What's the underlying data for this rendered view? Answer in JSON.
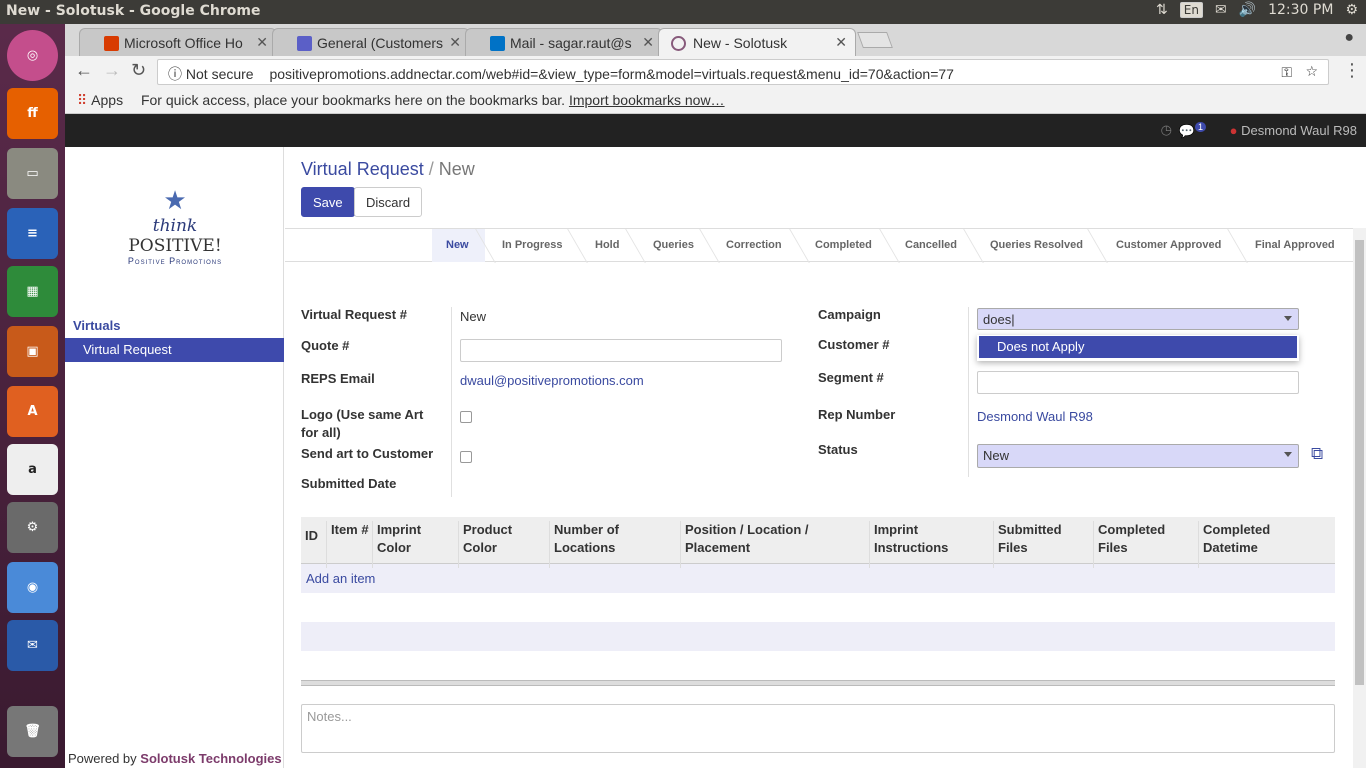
{
  "os": {
    "window_title": "New - Solotusk - Google Chrome",
    "lang": "En",
    "time": "12:30 PM"
  },
  "browser": {
    "tabs": [
      {
        "label": "Microsoft Office Ho",
        "favicon": "office-icon"
      },
      {
        "label": "General (Customers",
        "favicon": "teams-icon"
      },
      {
        "label": "Mail - sagar.raut@s",
        "favicon": "outlook-icon"
      },
      {
        "label": "New - Solotusk",
        "favicon": "odoo-icon"
      }
    ],
    "security": "Not secure",
    "url": "positivepromotions.addnectar.com/web#id=&view_type=form&model=virtuals.request&menu_id=70&action=77",
    "bookmarks_apps": "Apps",
    "bookmarks_hint": "For quick access, place your bookmarks here on the bookmarks bar.",
    "bookmarks_import": "Import bookmarks now…"
  },
  "app": {
    "user": "Desmond Waul R98",
    "chat_count": "1",
    "logo": {
      "line1": "think",
      "line2": "POSITIVE!",
      "line3": "Positive Promotions"
    },
    "sidebar": {
      "section": "Virtuals",
      "item": "Virtual Request"
    },
    "powered_prefix": "Powered by",
    "powered_by": "Solotusk Technologies",
    "breadcrumb": {
      "parent": "Virtual Request",
      "current": "New"
    },
    "buttons": {
      "save": "Save",
      "discard": "Discard"
    },
    "statuses": [
      "New",
      "In Progress",
      "Hold",
      "Queries",
      "Correction",
      "Completed",
      "Cancelled",
      "Queries Resolved",
      "Customer Approved",
      "Final Approved"
    ],
    "form": {
      "vr_label": "Virtual Request #",
      "vr_value": "New",
      "quote_label": "Quote #",
      "email_label": "REPS Email",
      "email_value": "dwaul@positivepromotions.com",
      "logo_label": "Logo (Use same Art for all)",
      "sendart_label": "Send art to Customer",
      "submitted_label": "Submitted Date",
      "campaign_label": "Campaign",
      "campaign_value": "does",
      "campaign_option": "Does not Apply",
      "customer_label": "Customer #",
      "segment_label": "Segment #",
      "rep_label": "Rep Number",
      "rep_value": "Desmond Waul R98",
      "status_label": "Status",
      "status_value": "New"
    },
    "table": {
      "headers": [
        "ID",
        "Item #",
        "Imprint Color",
        "Product Color",
        "Number of Locations",
        "Position / Location / Placement",
        "Imprint Instructions",
        "Submitted Files",
        "Completed Files",
        "Completed Datetime"
      ],
      "add_item": "Add an item"
    },
    "notes_placeholder": "Notes..."
  }
}
